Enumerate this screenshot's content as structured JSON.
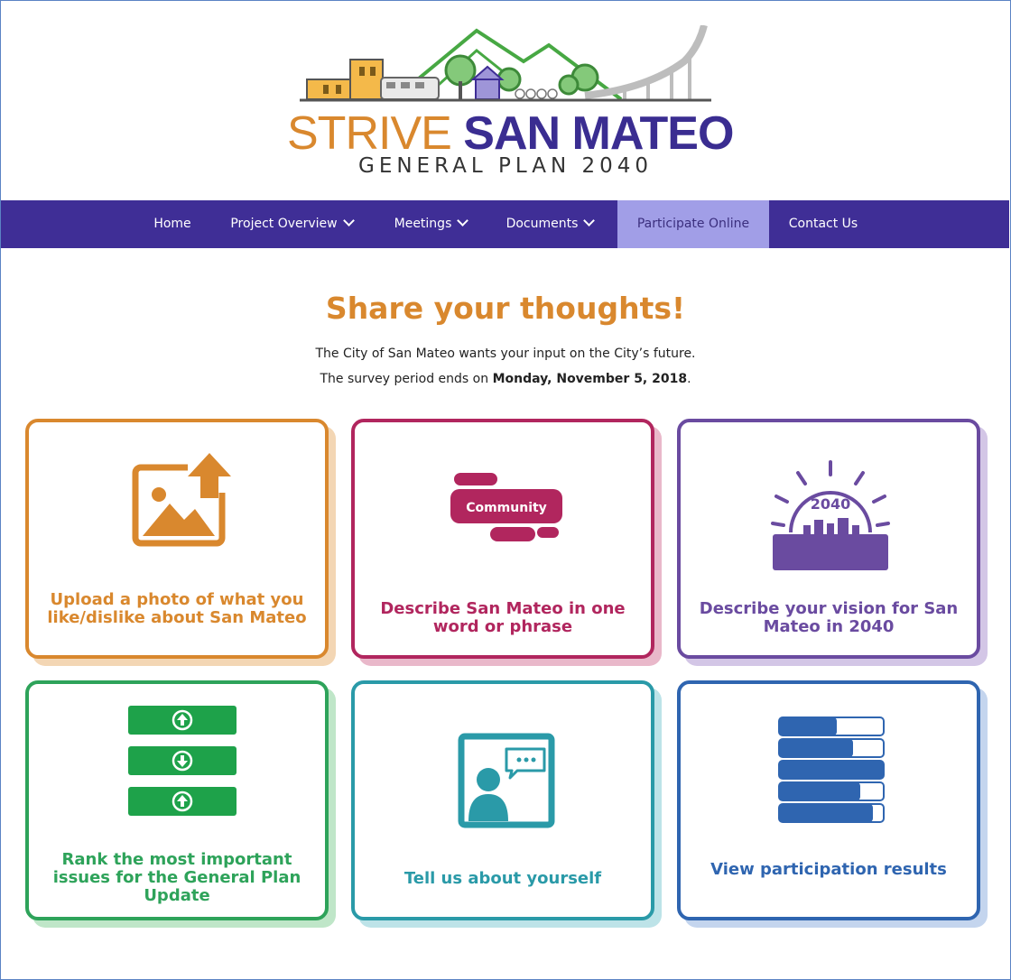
{
  "logo": {
    "title_word1": "STRIVE",
    "title_word2": "SAN MATEO",
    "subtitle": "GENERAL PLAN 2040"
  },
  "nav": {
    "items": [
      {
        "label": "Home",
        "has_dropdown": false
      },
      {
        "label": "Project Overview",
        "has_dropdown": true
      },
      {
        "label": "Meetings",
        "has_dropdown": true
      },
      {
        "label": "Documents",
        "has_dropdown": true
      },
      {
        "label": "Participate Online",
        "has_dropdown": false,
        "active": true
      },
      {
        "label": "Contact Us",
        "has_dropdown": false
      }
    ]
  },
  "intro": {
    "heading": "Share your thoughts!",
    "line1": "The City of San Mateo wants your input on the City’s future.",
    "line2_prefix": "The survey period ends on ",
    "line2_date": "Monday, November 5, 2018",
    "line2_suffix": "."
  },
  "cards": [
    {
      "label": "Upload a photo of what you like/dislike about San Mateo",
      "icon": "photo-upload-icon",
      "color": "#d9882e"
    },
    {
      "label": "Describe San Mateo in one word or phrase",
      "icon": "word-bubble-icon",
      "icon_text": "Community",
      "color": "#b1265e"
    },
    {
      "label": "Describe your vision for San Mateo in 2040",
      "icon": "sunrise-city-icon",
      "icon_text": "2040",
      "color": "#6a4ba0"
    },
    {
      "label": "Rank the most important issues for the General Plan Update",
      "icon": "ranking-icon",
      "color": "#2ea35a"
    },
    {
      "label": "Tell us about yourself",
      "icon": "profile-chat-icon",
      "color": "#2a9aa8"
    },
    {
      "label": "View participation results",
      "icon": "results-bars-icon",
      "color": "#2f65b0"
    }
  ],
  "colors": {
    "nav_bg": "#3f2e96",
    "nav_active_bg": "#a19ee7",
    "heading": "#d9882e"
  }
}
